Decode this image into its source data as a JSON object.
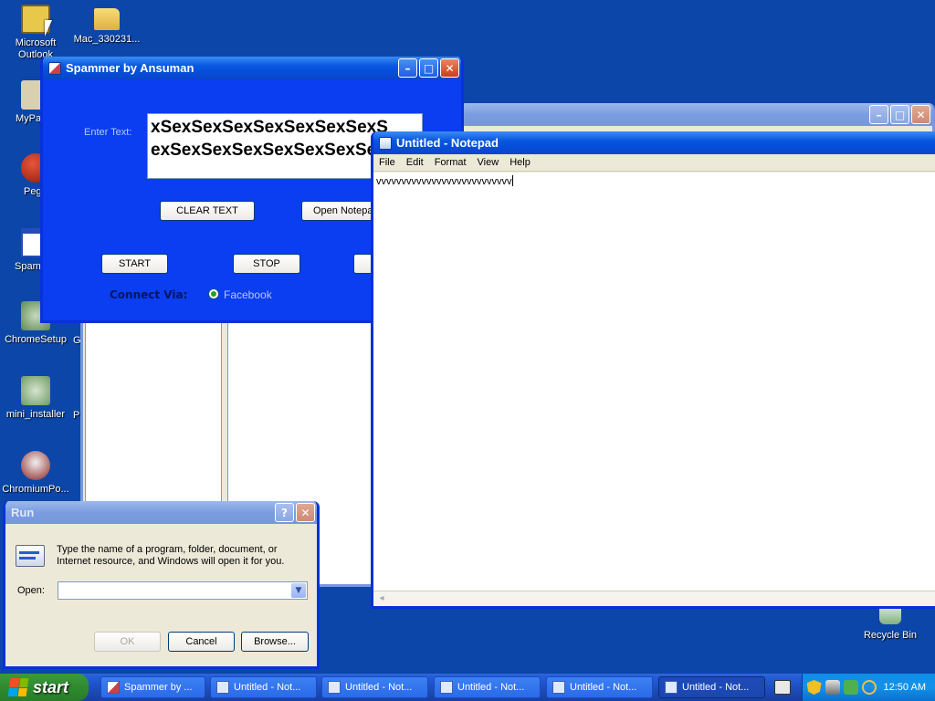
{
  "desktop": {
    "icons": [
      {
        "label": "Microsoft Outlook"
      },
      {
        "label": "Mac_330231..."
      },
      {
        "label": "MyPa"
      },
      {
        "label": "Peg"
      },
      {
        "label": "Spam"
      },
      {
        "label": "ChromeSetup"
      },
      {
        "label": "G"
      },
      {
        "label": "mini_installer"
      },
      {
        "label": "Pr"
      },
      {
        "label": "ChromiumPo..."
      },
      {
        "label": "Recycle Bin"
      }
    ]
  },
  "spammer": {
    "title": "Spammer by Ansuman",
    "enter_text_label": "Enter Text:",
    "text_value": "xSexSexSexSexSexSexSexS\nexSexSexSexSexSexSexSex",
    "clear_label": "CLEAR TEXT",
    "open_notepad_label": "Open Notepad",
    "start_label": "START",
    "stop_label": "STOP",
    "connect_label": "Connect Via:",
    "radio_label": "Facebook"
  },
  "notepad": {
    "title": "Untitled - Notepad",
    "menu": [
      "File",
      "Edit",
      "Format",
      "View",
      "Help"
    ],
    "content": "vvvvvvvvvvvvvvvvvvvvvvvvvvv"
  },
  "run": {
    "title": "Run",
    "help_btn": "?",
    "description": "Type the name of a program, folder, document, or Internet resource, and Windows will open it for you.",
    "open_label": "Open:",
    "open_value": "",
    "ok_label": "OK",
    "cancel_label": "Cancel",
    "browse_label": "Browse..."
  },
  "taskbar": {
    "start_label": "start",
    "tasks": [
      {
        "label": "Spammer by ..."
      },
      {
        "label": "Untitled - Not..."
      },
      {
        "label": "Untitled - Not..."
      },
      {
        "label": "Untitled - Not..."
      },
      {
        "label": "Untitled - Not..."
      },
      {
        "label": "Untitled - Not..."
      }
    ],
    "clock": "12:50 AM"
  },
  "colors": {
    "desktop": "#0b46a8",
    "spammer_bg": "#0a3ef0",
    "start_green": "#2f8a2f"
  }
}
